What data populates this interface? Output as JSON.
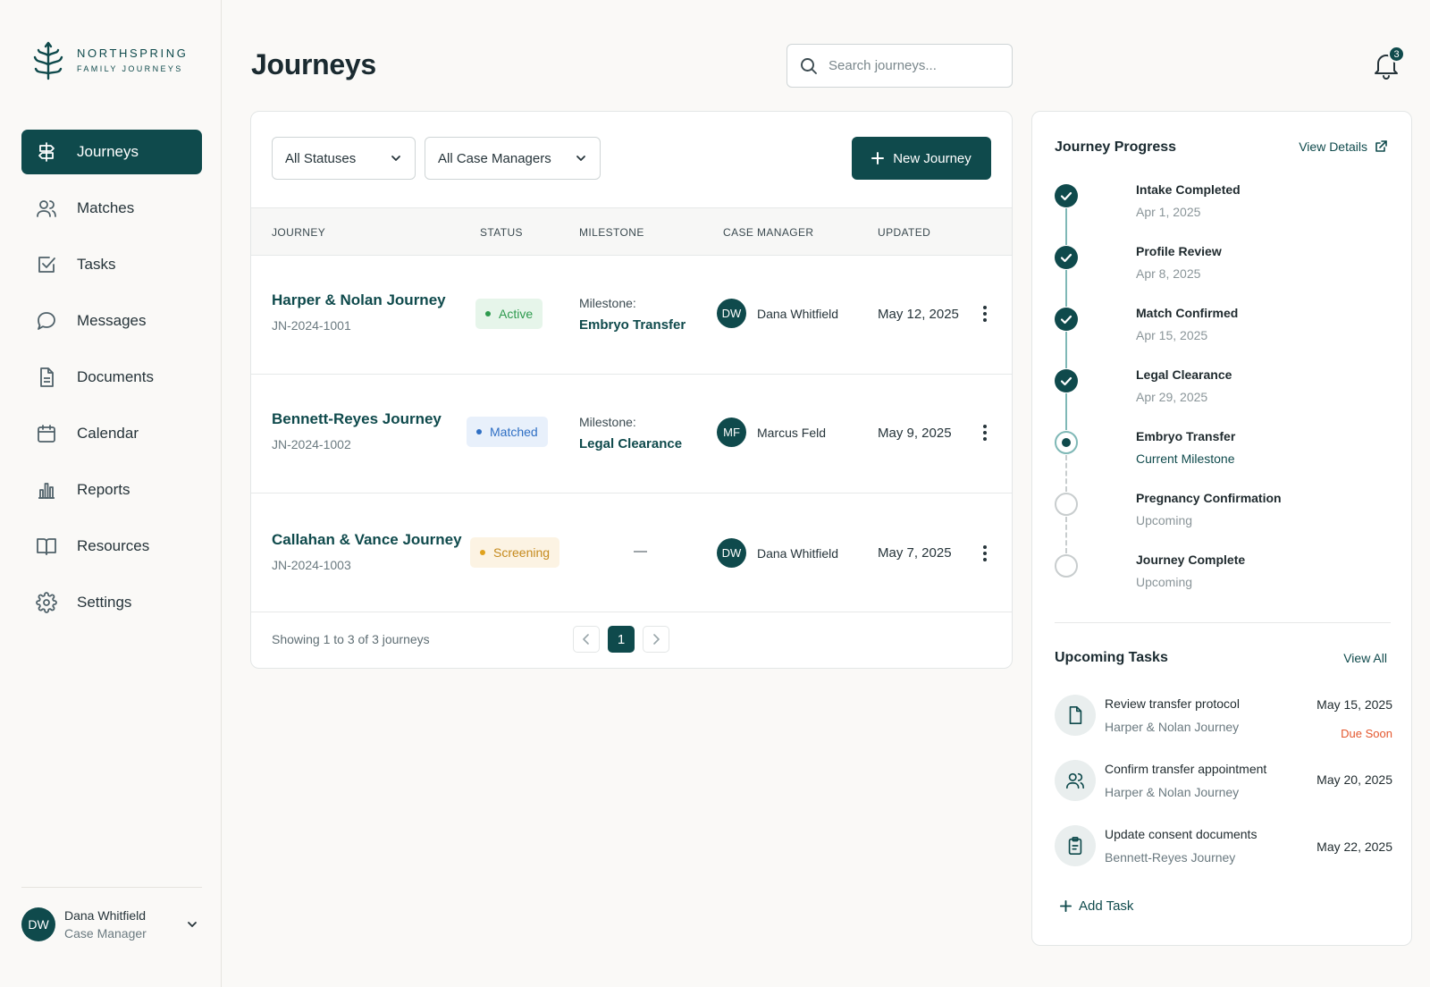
{
  "brand": {
    "name": "NORTHSPRING",
    "tagline": "FAMILY JOURNEYS"
  },
  "sidebar": {
    "items": [
      {
        "label": "Journeys",
        "icon": "signpost-icon",
        "active": true
      },
      {
        "label": "Matches",
        "icon": "users-icon"
      },
      {
        "label": "Tasks",
        "icon": "checkbox-icon"
      },
      {
        "label": "Messages",
        "icon": "message-icon"
      },
      {
        "label": "Documents",
        "icon": "document-icon"
      },
      {
        "label": "Calendar",
        "icon": "calendar-icon"
      },
      {
        "label": "Reports",
        "icon": "bar-chart-icon"
      },
      {
        "label": "Resources",
        "icon": "book-icon"
      },
      {
        "label": "Settings",
        "icon": "gear-icon"
      }
    ]
  },
  "user": {
    "initials": "DW",
    "name": "Dana Whitfield",
    "role": "Case Manager"
  },
  "header": {
    "title": "Journeys",
    "search_placeholder": "Search journeys...",
    "notification_count": "3"
  },
  "filters": {
    "status": "All Statuses",
    "manager": "All Case Managers",
    "new_button": "New Journey"
  },
  "table": {
    "columns": [
      "JOURNEY",
      "STATUS",
      "MILESTONE",
      "CASE MANAGER",
      "UPDATED"
    ],
    "rows": [
      {
        "name": "Harper & Nolan Journey",
        "id": "JN-2024-1001",
        "status": "Active",
        "status_color": "#2e9a4e",
        "status_bg": "#e6f5ea",
        "milestone_label": "Milestone:",
        "milestone": "Embryo Transfer",
        "manager_initials": "DW",
        "manager": "Dana Whitfield",
        "updated": "May 12, 2025"
      },
      {
        "name": "Bennett-Reyes Journey",
        "id": "JN-2024-1002",
        "status": "Matched",
        "status_color": "#2f6fc4",
        "status_bg": "#e8f0fb",
        "milestone_label": "Milestone:",
        "milestone": "Legal Clearance",
        "manager_initials": "MF",
        "manager": "Marcus Feld",
        "updated": "May 9, 2025"
      },
      {
        "name": "Callahan & Vance Journey",
        "id": "JN-2024-1003",
        "status": "Screening",
        "status_color": "#c58a1d",
        "status_bg": "#fcf3e3",
        "milestone_label": "",
        "milestone": "—",
        "manager_initials": "DW",
        "manager": "Dana Whitfield",
        "updated": "May 7, 2025"
      }
    ],
    "footer": "Showing 1 to 3 of 3 journeys",
    "current_page": "1"
  },
  "progress": {
    "title": "Journey Progress",
    "link": "View Details",
    "steps": [
      {
        "title": "Intake Completed",
        "sub": "Apr 1, 2025",
        "state": "done"
      },
      {
        "title": "Profile Review",
        "sub": "Apr 8, 2025",
        "state": "done"
      },
      {
        "title": "Match Confirmed",
        "sub": "Apr 15, 2025",
        "state": "done"
      },
      {
        "title": "Legal Clearance",
        "sub": "Apr 29, 2025",
        "state": "done"
      },
      {
        "title": "Embryo Transfer",
        "sub": "Current Milestone",
        "state": "current"
      },
      {
        "title": "Pregnancy Confirmation",
        "sub": "Upcoming",
        "state": "upcoming"
      },
      {
        "title": "Journey Complete",
        "sub": "Upcoming",
        "state": "upcoming"
      }
    ]
  },
  "tasks": {
    "title": "Upcoming Tasks",
    "link": "View All",
    "items": [
      {
        "title": "Review transfer protocol",
        "journey": "Harper & Nolan Journey",
        "date": "May 15, 2025",
        "due": "Due Soon",
        "icon": "document-icon"
      },
      {
        "title": "Confirm transfer appointment",
        "journey": "Harper & Nolan Journey",
        "date": "May 20, 2025",
        "due": "",
        "icon": "users-icon"
      },
      {
        "title": "Update consent documents",
        "journey": "Bennett-Reyes Journey",
        "date": "May 22, 2025",
        "due": "",
        "icon": "clipboard-icon"
      }
    ],
    "add_label": "Add Task"
  },
  "colors": {
    "brand": "#0f4a4c",
    "timeline": "#7fb8b6",
    "due": "#e4572e"
  }
}
